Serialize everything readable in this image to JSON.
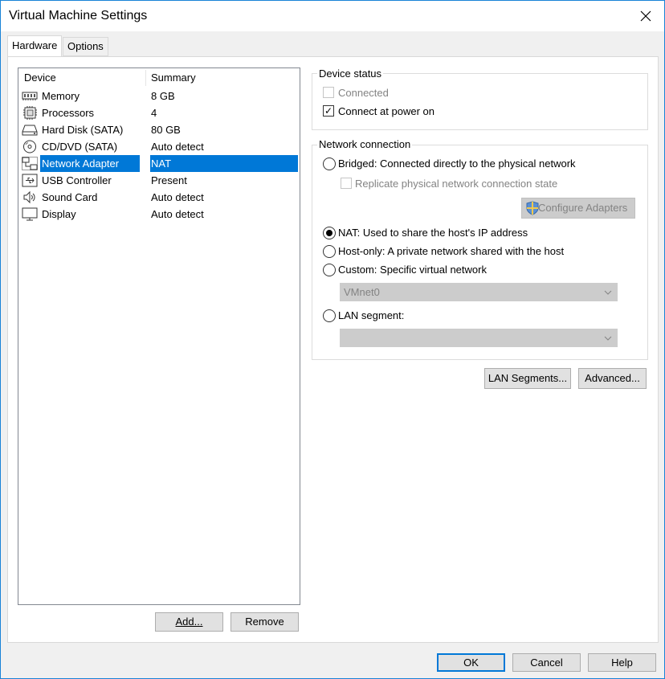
{
  "window": {
    "title": "Virtual Machine Settings"
  },
  "tabs": [
    {
      "label": "Hardware",
      "active": true
    },
    {
      "label": "Options",
      "active": false
    }
  ],
  "device_list": {
    "columns": [
      "Device",
      "Summary"
    ],
    "rows": [
      {
        "icon": "memory-icon",
        "device": "Memory",
        "summary": "8 GB",
        "selected": false
      },
      {
        "icon": "processor-icon",
        "device": "Processors",
        "summary": "4",
        "selected": false
      },
      {
        "icon": "hard-disk-icon",
        "device": "Hard Disk (SATA)",
        "summary": "80 GB",
        "selected": false
      },
      {
        "icon": "cd-dvd-icon",
        "device": "CD/DVD (SATA)",
        "summary": "Auto detect",
        "selected": false
      },
      {
        "icon": "network-adapter-icon",
        "device": "Network Adapter",
        "summary": "NAT",
        "selected": true
      },
      {
        "icon": "usb-controller-icon",
        "device": "USB Controller",
        "summary": "Present",
        "selected": false
      },
      {
        "icon": "sound-card-icon",
        "device": "Sound Card",
        "summary": "Auto detect",
        "selected": false
      },
      {
        "icon": "display-icon",
        "device": "Display",
        "summary": "Auto detect",
        "selected": false
      }
    ]
  },
  "list_buttons": {
    "add": "Add...",
    "remove": "Remove"
  },
  "device_status": {
    "title": "Device status",
    "connected": {
      "label": "Connected",
      "checked": false,
      "enabled": false
    },
    "connect_at_power_on": {
      "label": "Connect at power on",
      "checked": true,
      "enabled": true
    }
  },
  "network_connection": {
    "title": "Network connection",
    "bridged": {
      "label_key": "Bridged",
      "label_rest": ": Connected directly to the physical network",
      "selected": false
    },
    "replicate": {
      "label": "Replicate physical network connection state",
      "checked": false,
      "enabled": false
    },
    "configure_adapters": "Configure Adapters",
    "nat": {
      "label_key": "NAT",
      "label_rest": ": Used to share the host's IP address",
      "selected": true
    },
    "host_only": {
      "label_key": "Host-only",
      "label_rest": ": A private network shared with the host",
      "selected": false
    },
    "custom": {
      "label_key": "Custom",
      "label_rest": ": Specific virtual network",
      "selected": false
    },
    "custom_network_value": "VMnet0",
    "lan_segment": {
      "label": "LAN segment:",
      "selected": false
    },
    "lan_segment_value": ""
  },
  "action_buttons": {
    "lan_segments": "LAN Segments...",
    "advanced": "Advanced..."
  },
  "footer": {
    "ok": "OK",
    "cancel": "Cancel",
    "help": "Help"
  },
  "colors": {
    "accent": "#0078d7",
    "disabled_text": "#838383"
  }
}
